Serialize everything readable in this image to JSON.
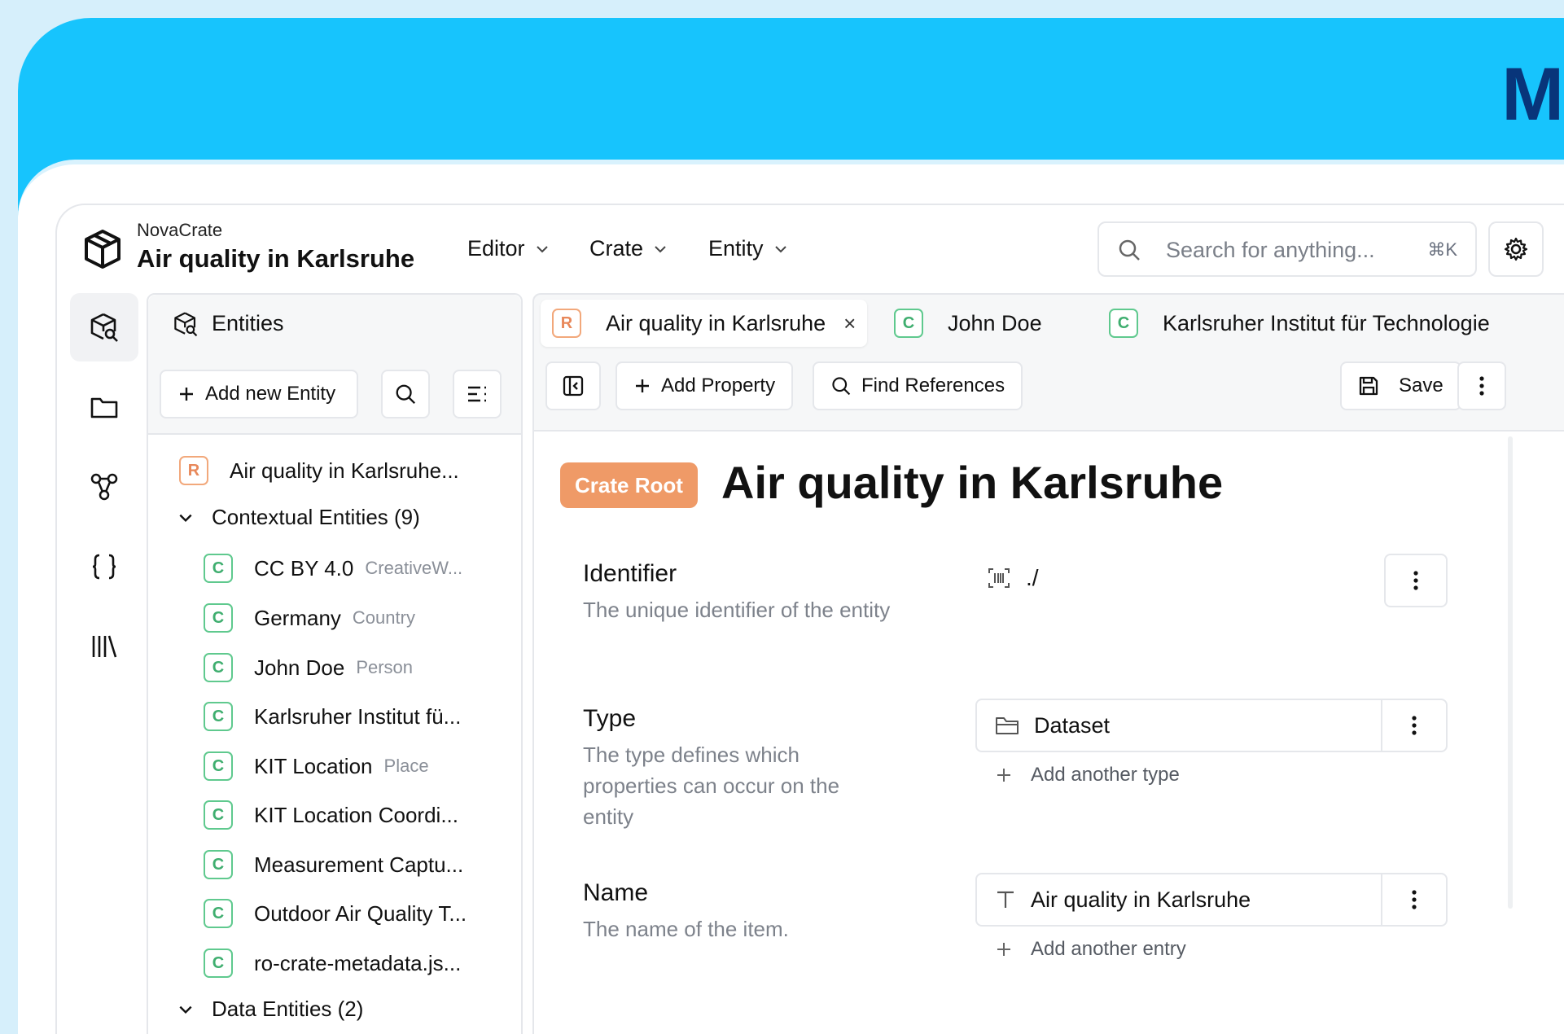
{
  "banner": {
    "letter": "M"
  },
  "header": {
    "app_name": "NovaCrate",
    "crate_title": "Air quality in Karlsruhe",
    "menus": [
      "Editor",
      "Crate",
      "Entity"
    ],
    "search_placeholder": "Search for anything...",
    "search_shortcut": "⌘K"
  },
  "rail": {
    "icons": [
      "entities-icon",
      "folder-icon",
      "graph-icon",
      "json-icon",
      "library-icon"
    ]
  },
  "entities_panel": {
    "title": "Entities",
    "add_button": "Add new Entity",
    "root": {
      "badge": "R",
      "label": "Air quality in Karlsruhe..."
    },
    "contextual_group": "Contextual Entities (9)",
    "contextual": [
      {
        "badge": "C",
        "name": "CC BY 4.0",
        "type": "CreativeW..."
      },
      {
        "badge": "C",
        "name": "Germany",
        "type": "Country"
      },
      {
        "badge": "C",
        "name": "John Doe",
        "type": "Person"
      },
      {
        "badge": "C",
        "name": "Karlsruher Institut fü...",
        "type": ""
      },
      {
        "badge": "C",
        "name": "KIT Location",
        "type": "Place"
      },
      {
        "badge": "C",
        "name": "KIT Location Coordi...",
        "type": ""
      },
      {
        "badge": "C",
        "name": "Measurement Captu...",
        "type": ""
      },
      {
        "badge": "C",
        "name": "Outdoor Air Quality T...",
        "type": ""
      },
      {
        "badge": "C",
        "name": "ro-crate-metadata.js...",
        "type": ""
      }
    ],
    "data_group": "Data Entities (2)"
  },
  "tabs": [
    {
      "badge": "R",
      "label": "Air quality in Karlsruhe",
      "close": "×"
    },
    {
      "badge": "C",
      "label": "John Doe"
    },
    {
      "badge": "C",
      "label": "Karlsruher Institut für Technologie"
    }
  ],
  "toolbar": {
    "add_property": "Add Property",
    "find_references": "Find References",
    "save": "Save"
  },
  "entity": {
    "badge": "Crate Root",
    "title": "Air quality in Karlsruhe",
    "properties": {
      "identifier": {
        "name": "Identifier",
        "description": "The unique identifier of the entity",
        "value": "./"
      },
      "type": {
        "name": "Type",
        "description": "The type defines which properties can occur on the entity",
        "value": "Dataset",
        "add": "Add another type"
      },
      "name": {
        "name": "Name",
        "description": "The name of the item.",
        "value": "Air quality in Karlsruhe",
        "add": "Add another entry"
      }
    }
  },
  "colors": {
    "banner": "#17c4fd",
    "root_badge": "#ef9a67",
    "contextual_badge": "#3fae6f"
  }
}
